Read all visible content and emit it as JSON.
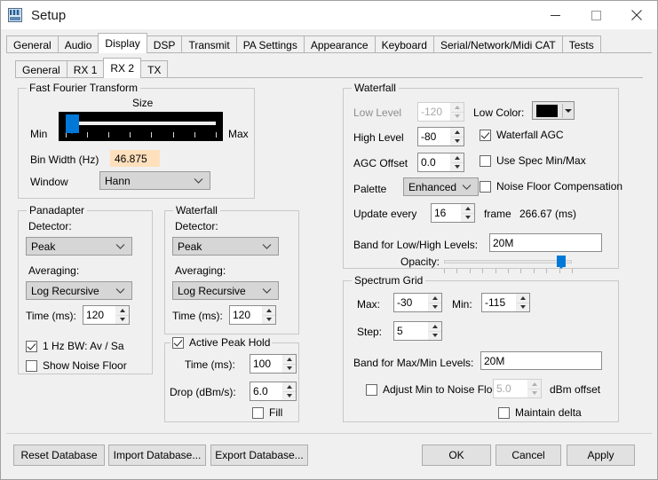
{
  "window": {
    "title": "Setup",
    "icon": "app-icon",
    "minimize": "—",
    "maximize": "□",
    "close": "✕"
  },
  "tabs_primary": [
    {
      "label": "General",
      "selected": false
    },
    {
      "label": "Audio",
      "selected": false
    },
    {
      "label": "Display",
      "selected": true
    },
    {
      "label": "DSP",
      "selected": false
    },
    {
      "label": "Transmit",
      "selected": false
    },
    {
      "label": "PA Settings",
      "selected": false
    },
    {
      "label": "Appearance",
      "selected": false
    },
    {
      "label": "Keyboard",
      "selected": false
    },
    {
      "label": "Serial/Network/Midi CAT",
      "selected": false
    },
    {
      "label": "Tests",
      "selected": false
    }
  ],
  "tabs_secondary": [
    {
      "label": "General",
      "selected": false
    },
    {
      "label": "RX 1",
      "selected": false
    },
    {
      "label": "RX 2",
      "selected": true
    },
    {
      "label": "TX",
      "selected": false
    }
  ],
  "fft": {
    "group_label": "Fast Fourier Transform",
    "size_label": "Size",
    "min_label": "Min",
    "max_label": "Max",
    "slider_percent": 4,
    "bin_width_label": "Bin Width (Hz)",
    "bin_width_value": "46.875",
    "window_label": "Window",
    "window_value": "Hann"
  },
  "panadapter": {
    "group_label": "Panadapter",
    "detector_label": "Detector:",
    "detector_value": "Peak",
    "averaging_label": "Averaging:",
    "averaging_value": "Log Recursive",
    "time_label": "Time (ms):",
    "time_value": "120",
    "hz_bw_label": "1 Hz BW: Av / Sa",
    "hz_bw_checked": true,
    "show_noise_floor_label": "Show Noise Floor",
    "show_noise_floor_checked": false
  },
  "waterfall_left": {
    "group_label": "Waterfall",
    "detector_label": "Detector:",
    "detector_value": "Peak",
    "averaging_label": "Averaging:",
    "averaging_value": "Log Recursive",
    "time_label": "Time (ms):",
    "time_value": "120"
  },
  "peak_hold": {
    "group_label": "Active Peak Hold",
    "group_checked": true,
    "time_label": "Time (ms):",
    "time_value": "100",
    "drop_label": "Drop (dBm/s):",
    "drop_value": "6.0",
    "fill_label": "Fill",
    "fill_checked": false
  },
  "waterfall_right": {
    "group_label": "Waterfall",
    "low_level_label": "Low Level",
    "low_level_value": "-120",
    "low_level_disabled": true,
    "high_level_label": "High Level",
    "high_level_value": "-80",
    "agc_offset_label": "AGC Offset",
    "agc_offset_value": "0.0",
    "palette_label": "Palette",
    "palette_value": "Enhanced",
    "low_color_label": "Low Color:",
    "low_color_value": "#000000",
    "waterfall_agc_label": "Waterfall AGC",
    "waterfall_agc_checked": true,
    "use_spec_label": "Use Spec Min/Max",
    "use_spec_checked": false,
    "noise_floor_comp_label": "Noise Floor Compensation",
    "noise_floor_comp_checked": false,
    "update_every_label": "Update every",
    "update_every_value": "16",
    "frame_label": "frame",
    "frame_ms": "266.67 (ms)",
    "band_label": "Band for Low/High Levels:",
    "band_value": "20M",
    "opacity_label": "Opacity:",
    "opacity_percent": 92
  },
  "spectrum_grid": {
    "group_label": "Spectrum Grid",
    "max_label": "Max:",
    "max_value": "-30",
    "min_label": "Min:",
    "min_value": "-115",
    "step_label": "Step:",
    "step_value": "5",
    "band_label": "Band for Max/Min Levels:",
    "band_value": "20M",
    "adjust_min_label": "Adjust Min to Noise Floor",
    "adjust_min_checked": false,
    "dbm_offset_value": "5.0",
    "dbm_offset_disabled": true,
    "dbm_offset_label": "dBm offset",
    "maintain_delta_label": "Maintain delta",
    "maintain_delta_checked": false
  },
  "footer": {
    "reset_database": "Reset Database",
    "import_database": "Import Database...",
    "export_database": "Export Database...",
    "ok": "OK",
    "cancel": "Cancel",
    "apply": "Apply"
  }
}
